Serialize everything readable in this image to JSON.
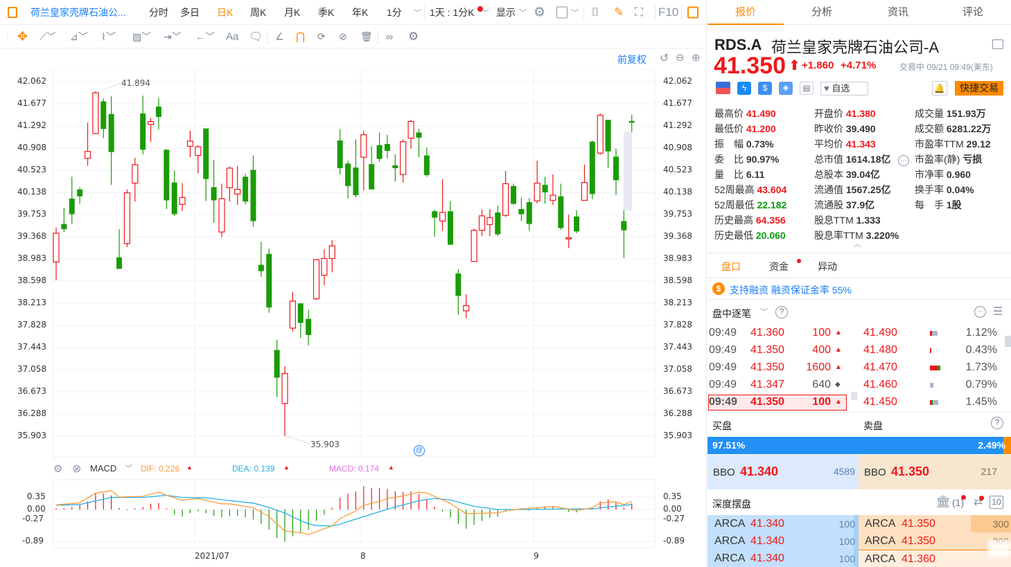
{
  "toolbar": {
    "stock_short": "荷兰皇家壳牌石油公...",
    "periods": [
      "分时",
      "多日",
      "日K",
      "周K",
      "月K",
      "季K",
      "年K",
      "1分"
    ],
    "active_period": "日K",
    "range": "1天 : 1分K",
    "display": "显示",
    "f10": "F10",
    "text_tool": "Aa"
  },
  "chart_header": {
    "adjust": "前复权"
  },
  "chart_data": {
    "type": "candlestick",
    "y_ticks": [
      "42.062",
      "41.677",
      "41.292",
      "40.908",
      "40.523",
      "40.138",
      "39.753",
      "39.368",
      "38.983",
      "38.598",
      "38.213",
      "37.828",
      "37.443",
      "37.058",
      "36.673",
      "36.288",
      "35.903"
    ],
    "ylim": [
      35.903,
      42.062
    ],
    "max_label": "41.894",
    "min_label": "35.903",
    "x_labels": [
      {
        "text": "2021/07",
        "index": 18
      },
      {
        "text": "8",
        "index": 39
      },
      {
        "text": "9",
        "index": 61
      }
    ],
    "candles": [
      [
        38.93,
        39.53,
        38.61,
        39.43
      ],
      [
        39.59,
        39.87,
        39.45,
        39.5
      ],
      [
        40.03,
        40.41,
        39.59,
        39.76
      ],
      [
        40.19,
        40.23,
        39.94,
        40.07
      ],
      [
        40.73,
        41.35,
        40.6,
        40.85
      ],
      [
        41.16,
        41.894,
        41.15,
        41.87
      ],
      [
        41.72,
        41.77,
        41.08,
        41.24
      ],
      [
        41.5,
        41.81,
        40.27,
        40.84
      ],
      [
        39.01,
        39.5,
        38.81,
        38.81
      ],
      [
        39.25,
        40.19,
        39.19,
        40.13
      ],
      [
        40.3,
        40.74,
        39.98,
        40.62
      ],
      [
        41.51,
        41.82,
        40.8,
        40.88
      ],
      [
        41.32,
        41.43,
        41.02,
        41.37
      ],
      [
        41.63,
        41.78,
        41.23,
        41.45
      ],
      [
        40.88,
        40.89,
        39.85,
        40.0
      ],
      [
        40.31,
        40.52,
        39.73,
        39.76
      ],
      [
        39.93,
        40.3,
        39.81,
        40.05
      ],
      [
        40.94,
        41.21,
        40.75,
        41.03
      ],
      [
        40.78,
        40.96,
        40.47,
        40.93
      ],
      [
        41.25,
        41.25,
        39.99,
        40.37
      ],
      [
        40.23,
        40.7,
        39.61,
        40.0
      ],
      [
        39.45,
        40.29,
        39.36,
        40.03
      ],
      [
        40.22,
        40.59,
        39.98,
        40.56
      ],
      [
        40.11,
        40.6,
        39.92,
        40.19
      ],
      [
        40.41,
        40.46,
        39.93,
        39.98
      ],
      [
        40.53,
        40.78,
        39.54,
        39.64
      ],
      [
        38.88,
        39.28,
        38.67,
        38.77
      ],
      [
        39.07,
        39.16,
        38.05,
        38.14
      ],
      [
        37.4,
        37.58,
        36.58,
        36.92
      ],
      [
        36.47,
        37.12,
        35.903,
        36.99
      ],
      [
        37.78,
        38.41,
        37.72,
        38.25
      ],
      [
        38.21,
        38.21,
        37.61,
        37.87
      ],
      [
        37.94,
        38.1,
        37.48,
        37.66
      ],
      [
        38.29,
        38.98,
        38.27,
        38.97
      ],
      [
        38.7,
        39.15,
        38.52,
        38.99
      ],
      [
        38.99,
        39.31,
        38.75,
        39.21
      ],
      [
        41.04,
        41.24,
        40.45,
        40.56
      ],
      [
        40.64,
        40.69,
        40.03,
        40.25
      ],
      [
        40.57,
        41.06,
        40.05,
        40.09
      ],
      [
        40.75,
        41.21,
        40.17,
        41.14
      ],
      [
        40.63,
        40.94,
        40.19,
        40.19
      ],
      [
        40.96,
        41.18,
        40.67,
        40.72
      ],
      [
        40.98,
        41.14,
        40.73,
        40.86
      ],
      [
        40.61,
        40.8,
        40.33,
        40.56
      ],
      [
        40.45,
        41.06,
        40.31,
        41.02
      ],
      [
        41.08,
        41.4,
        40.9,
        41.37
      ],
      [
        41.18,
        41.24,
        40.75,
        41.09
      ],
      [
        40.78,
        40.92,
        40.41,
        40.44
      ],
      [
        39.81,
        39.84,
        39.37,
        39.7
      ],
      [
        39.64,
        40.37,
        39.47,
        39.79
      ],
      [
        39.81,
        39.99,
        39.22,
        39.23
      ],
      [
        38.73,
        38.8,
        38.01,
        38.34
      ],
      [
        38.08,
        38.37,
        37.95,
        38.17
      ],
      [
        38.94,
        39.51,
        38.93,
        39.48
      ],
      [
        39.48,
        39.84,
        39.38,
        39.73
      ],
      [
        39.58,
        39.85,
        39.38,
        39.7
      ],
      [
        39.79,
        39.91,
        39.38,
        39.41
      ],
      [
        39.74,
        40.51,
        39.71,
        40.29
      ],
      [
        40.25,
        40.29,
        39.92,
        39.94
      ],
      [
        39.85,
        40.05,
        39.64,
        39.76
      ],
      [
        39.97,
        40.04,
        39.47,
        39.59
      ],
      [
        39.99,
        40.69,
        39.95,
        40.3
      ],
      [
        40.27,
        40.41,
        39.94,
        40.14
      ],
      [
        40.0,
        40.45,
        39.92,
        40.09
      ],
      [
        40.07,
        40.29,
        39.49,
        39.52
      ],
      [
        39.33,
        39.75,
        39.17,
        39.35
      ],
      [
        39.72,
        39.83,
        39.43,
        39.46
      ],
      [
        40.0,
        40.62,
        40.0,
        40.31
      ],
      [
        41.02,
        41.04,
        40.02,
        40.11
      ],
      [
        40.82,
        41.51,
        40.79,
        41.48
      ],
      [
        41.4,
        41.4,
        40.57,
        40.85
      ],
      [
        40.76,
        40.9,
        40.09,
        40.35
      ],
      [
        39.64,
        39.83,
        39.0,
        39.48
      ],
      [
        41.38,
        41.49,
        41.19,
        41.35
      ]
    ],
    "macd": {
      "title": "MACD",
      "dif_label": "DIF: 0.226",
      "dea_label": "DEA: 0.139",
      "macd_label": "MACD: 0.174",
      "y_ticks": [
        "0.35",
        "0.00",
        "-0.27",
        "-0.89"
      ],
      "ylim": [
        -0.89,
        0.35
      ],
      "hist": [
        0.04,
        0.04,
        0.07,
        0.12,
        0.23,
        0.45,
        0.45,
        0.4,
        0.05,
        -0.02,
        0.03,
        0.07,
        0.16,
        0.19,
        0.03,
        -0.14,
        -0.2,
        -0.1,
        -0.05,
        -0.1,
        -0.18,
        -0.22,
        -0.19,
        -0.18,
        -0.22,
        -0.28,
        -0.41,
        -0.56,
        -0.8,
        -0.9,
        -0.75,
        -0.65,
        -0.57,
        -0.32,
        -0.15,
        0.05,
        0.33,
        0.45,
        0.51,
        0.66,
        0.6,
        0.6,
        0.58,
        0.51,
        0.49,
        0.51,
        0.44,
        0.29,
        0.08,
        -0.06,
        -0.22,
        -0.41,
        -0.54,
        -0.43,
        -0.32,
        -0.24,
        -0.2,
        -0.06,
        -0.03,
        0.0,
        -0.03,
        0.06,
        0.08,
        0.1,
        0.03,
        -0.06,
        -0.08,
        0.02,
        0.04,
        0.23,
        0.28,
        0.21,
        0.05,
        0.174
      ],
      "dif": [
        [
          0,
          0.13
        ],
        [
          3,
          0.19
        ],
        [
          5,
          0.46
        ],
        [
          7,
          0.53
        ],
        [
          8,
          0.35
        ],
        [
          11,
          0.37
        ],
        [
          13,
          0.49
        ],
        [
          14,
          0.4
        ],
        [
          16,
          0.26
        ],
        [
          18,
          0.31
        ],
        [
          21,
          0.16
        ],
        [
          22,
          0.16
        ],
        [
          25,
          0.05
        ],
        [
          27,
          -0.2
        ],
        [
          29,
          -0.6
        ],
        [
          31,
          -0.65
        ],
        [
          32,
          -0.7
        ],
        [
          35,
          -0.46
        ],
        [
          36,
          -0.25
        ],
        [
          38,
          -0.04
        ],
        [
          39,
          0.12
        ],
        [
          41,
          0.23
        ],
        [
          42,
          0.31
        ],
        [
          44,
          0.38
        ],
        [
          46,
          0.49
        ],
        [
          47,
          0.46
        ],
        [
          49,
          0.27
        ],
        [
          50,
          0.17
        ],
        [
          52,
          -0.12
        ],
        [
          56,
          -0.09
        ],
        [
          58,
          0
        ],
        [
          61,
          0.05
        ],
        [
          63,
          0.09
        ],
        [
          66,
          -0.03
        ],
        [
          68,
          0.05
        ],
        [
          69,
          0.18
        ],
        [
          70,
          0.21
        ],
        [
          71,
          0.21
        ],
        [
          72,
          0.14
        ],
        [
          73,
          0.226
        ]
      ],
      "dea": [
        [
          0,
          0.12
        ],
        [
          3,
          0.14
        ],
        [
          5,
          0.24
        ],
        [
          7,
          0.34
        ],
        [
          11,
          0.34
        ],
        [
          14,
          0.4
        ],
        [
          16,
          0.34
        ],
        [
          19,
          0.33
        ],
        [
          22,
          0.25
        ],
        [
          25,
          0.18
        ],
        [
          27,
          0.06
        ],
        [
          29,
          -0.1
        ],
        [
          31,
          -0.31
        ],
        [
          32,
          -0.4
        ],
        [
          33,
          -0.45
        ],
        [
          35,
          -0.46
        ],
        [
          36,
          -0.41
        ],
        [
          38,
          -0.27
        ],
        [
          42,
          0.01
        ],
        [
          46,
          0.25
        ],
        [
          48,
          0.31
        ],
        [
          50,
          0.27
        ],
        [
          53,
          0.09
        ],
        [
          56,
          0
        ],
        [
          59,
          0
        ],
        [
          62,
          0.01
        ],
        [
          68,
          0.02
        ],
        [
          70,
          0.07
        ],
        [
          73,
          0.139
        ]
      ]
    }
  },
  "colors": {
    "up": "#f0171a",
    "down": "#1a9c05",
    "accent": "#ff8a00",
    "dif": "#ff9a3c",
    "dea": "#22b0e8",
    "macd": "#e86ce8",
    "link": "#1b7ff5"
  },
  "quote": {
    "tabs": [
      "报价",
      "分析",
      "资讯",
      "评论"
    ],
    "symbol": "RDS.A",
    "name": "荷兰皇家壳牌石油公司-A",
    "price": "41.350",
    "change": "+1.860",
    "change_pct": "+4.71%",
    "status": "交易中 09/21 09:49(美东)",
    "watch_label": "自选",
    "trade_label": "快捷交易",
    "stats": [
      [
        {
          "label": "最高价",
          "value": "41.490",
          "c": "red"
        },
        {
          "label": "最低价",
          "value": "41.200",
          "c": "red"
        },
        {
          "label": "振　幅",
          "value": "0.73%",
          "c": ""
        },
        {
          "label": "委　比",
          "value": "90.97%",
          "c": ""
        },
        {
          "label": "量　比",
          "value": "6.11",
          "c": ""
        },
        {
          "label": "52周最高",
          "value": "43.604",
          "c": "red"
        },
        {
          "label": "52周最低",
          "value": "22.182",
          "c": "green"
        },
        {
          "label": "历史最高",
          "value": "64.356",
          "c": "red"
        },
        {
          "label": "历史最低",
          "value": "20.060",
          "c": "green"
        }
      ],
      [
        {
          "label": "开盘价",
          "value": "41.380",
          "c": "red"
        },
        {
          "label": "昨收价",
          "value": "39.490",
          "c": ""
        },
        {
          "label": "平均价",
          "value": "41.343",
          "c": "red"
        },
        {
          "label": "总市值",
          "value": "1614.18亿",
          "c": ""
        },
        {
          "label": "总股本",
          "value": "39.04亿",
          "c": ""
        },
        {
          "label": "流通值",
          "value": "1567.25亿",
          "c": ""
        },
        {
          "label": "流通股",
          "value": "37.9亿",
          "c": ""
        },
        {
          "label": "股息TTM",
          "value": "1.333",
          "c": ""
        },
        {
          "label": "股息率TTM",
          "value": "3.220%",
          "c": ""
        }
      ],
      [
        {
          "label": "成交量",
          "value": "151.93万",
          "c": ""
        },
        {
          "label": "成交额",
          "value": "6281.22万",
          "c": ""
        },
        {
          "label": "市盈率TTM",
          "value": "29.12",
          "c": ""
        },
        {
          "label": "市盈率(静)",
          "value": "亏损",
          "c": ""
        },
        {
          "label": "市净率",
          "value": "0.960",
          "c": ""
        },
        {
          "label": "换手率",
          "value": "0.04%",
          "c": ""
        },
        {
          "label": "每　手",
          "value": "1股",
          "c": ""
        }
      ]
    ]
  },
  "subtabs": [
    "盘口",
    "资金",
    "异动"
  ],
  "margin_note": "支持融资 融资保证金率 55%",
  "ticks": {
    "title": "盘中逐笔",
    "rows": [
      {
        "time": "09:49",
        "price": "41.360",
        "vol": "100",
        "dir": "▲",
        "level": "41.490",
        "pct": "1.12%"
      },
      {
        "time": "09:49",
        "price": "41.350",
        "vol": "400",
        "dir": "▲",
        "level": "41.480",
        "pct": "0.43%"
      },
      {
        "time": "09:49",
        "price": "41.350",
        "vol": "1600",
        "dir": "▲",
        "level": "41.470",
        "pct": "1.73%"
      },
      {
        "time": "09:49",
        "price": "41.347",
        "vol": "640",
        "dir": "◆",
        "level": "41.460",
        "pct": "0.79%"
      },
      {
        "time": "09:49",
        "price": "41.350",
        "vol": "100",
        "dir": "▲",
        "level": "41.450",
        "pct": "1.45%"
      }
    ]
  },
  "book": {
    "bid_title": "买盘",
    "ask_title": "卖盘",
    "bid_pct": "97.51%",
    "ask_pct": "2.49%",
    "bid_fraction": 0.9751,
    "bbo_label": "BBO",
    "bid_price": "41.340",
    "bid_size": "4589",
    "ask_price": "41.350",
    "ask_size": "217",
    "depth_title": "深度摆盘",
    "broker_count": "(1)",
    "levels": "10",
    "bids": [
      {
        "ex": "ARCA",
        "price": "41.340",
        "size": "100"
      },
      {
        "ex": "ARCA",
        "price": "41.340",
        "size": "100"
      },
      {
        "ex": "ARCA",
        "price": "41.340",
        "size": "100"
      }
    ],
    "asks": [
      {
        "ex": "ARCA",
        "price": "41.350",
        "size": "300"
      },
      {
        "ex": "ARCA",
        "price": "41.350",
        "size": "300"
      },
      {
        "ex": "ARCA",
        "price": "41.360",
        "size": ""
      }
    ]
  }
}
